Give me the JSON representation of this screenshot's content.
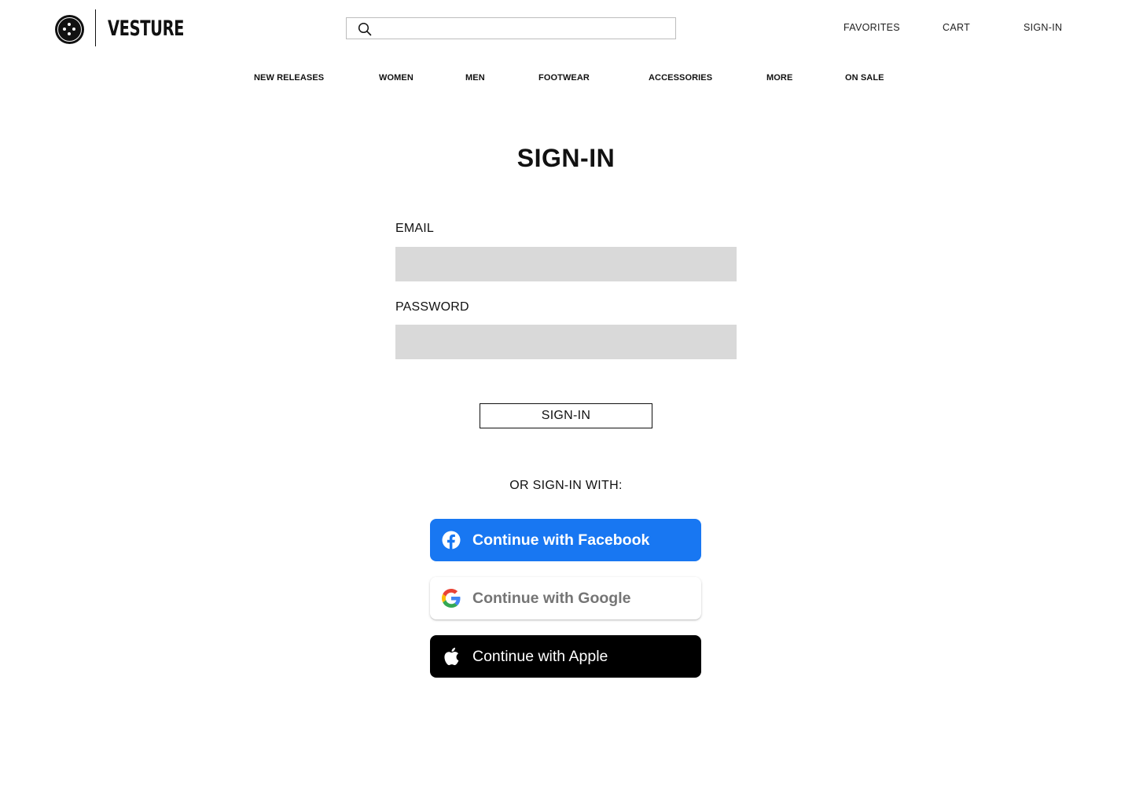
{
  "brand": {
    "name": "VESTURE"
  },
  "search": {
    "placeholder": "",
    "value": ""
  },
  "header_links": {
    "favorites": "FAVORITES",
    "cart": "CART",
    "sign_in": "SIGN-IN"
  },
  "nav": {
    "items": [
      {
        "label": "NEW RELEASES"
      },
      {
        "label": "WOMEN"
      },
      {
        "label": "MEN"
      },
      {
        "label": "FOOTWEAR"
      },
      {
        "label": "ACCESSORIES"
      },
      {
        "label": "MORE"
      },
      {
        "label": "ON SALE"
      }
    ]
  },
  "form": {
    "title": "SIGN-IN",
    "email_label": "EMAIL",
    "email_value": "",
    "password_label": "PASSWORD",
    "password_value": "",
    "submit_label": "SIGN-IN",
    "or_text": "OR SIGN-IN WITH:"
  },
  "social": {
    "facebook": {
      "label": "Continue with Facebook",
      "icon": "facebook-icon",
      "color": "#1877f2"
    },
    "google": {
      "label": "Continue with Google",
      "icon": "google-icon",
      "color": "#ffffff"
    },
    "apple": {
      "label": "Continue with Apple",
      "icon": "apple-icon",
      "color": "#000000"
    }
  },
  "colors": {
    "input_bg": "#d9d9d9",
    "text": "#111111"
  }
}
